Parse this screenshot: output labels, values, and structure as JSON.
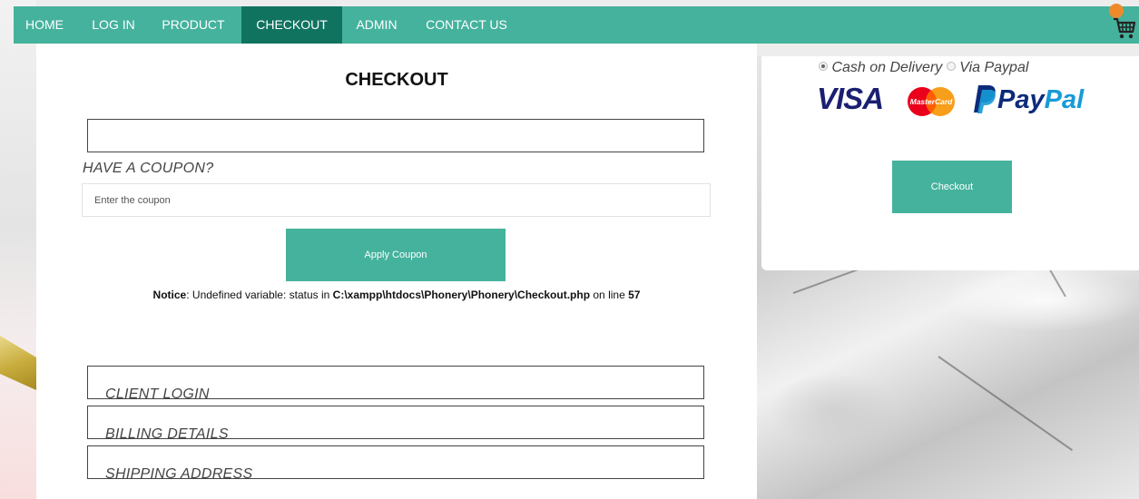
{
  "nav": {
    "items": [
      {
        "label": "HOME"
      },
      {
        "label": "LOG IN"
      },
      {
        "label": "PRODUCT"
      },
      {
        "label": "CHECKOUT",
        "active": true
      },
      {
        "label": "ADMIN"
      },
      {
        "label": "CONTACT US"
      }
    ],
    "cart_icon": "shopping-cart-icon"
  },
  "main": {
    "title": "CHECKOUT",
    "coupon": {
      "heading": "HAVE A COUPON?",
      "placeholder": "Enter the coupon",
      "value": "",
      "apply_label": "Apply Coupon"
    },
    "notice": {
      "label": "Notice",
      "message": ": Undefined variable: status in ",
      "path": "C:\\xampp\\htdocs\\Phonery\\Phonery\\Checkout.php",
      "line_text": " on line ",
      "line": "57"
    },
    "sections": [
      {
        "label": "CLIENT LOGIN"
      },
      {
        "label": "BILLING DETAILS"
      },
      {
        "label": "SHIPPING ADDRESS"
      }
    ]
  },
  "payment": {
    "options": [
      {
        "label": "Cash on Delivery",
        "checked": true
      },
      {
        "label": "Via Paypal",
        "checked": false
      }
    ],
    "logos": {
      "visa": "VISA",
      "mastercard": "MasterCard",
      "paypal_pay": "Pay",
      "paypal_pal": "Pal"
    },
    "checkout_label": "Checkout"
  },
  "colors": {
    "accent": "#45b29d",
    "accent_active": "#107360",
    "badge": "#ef8a2a"
  }
}
